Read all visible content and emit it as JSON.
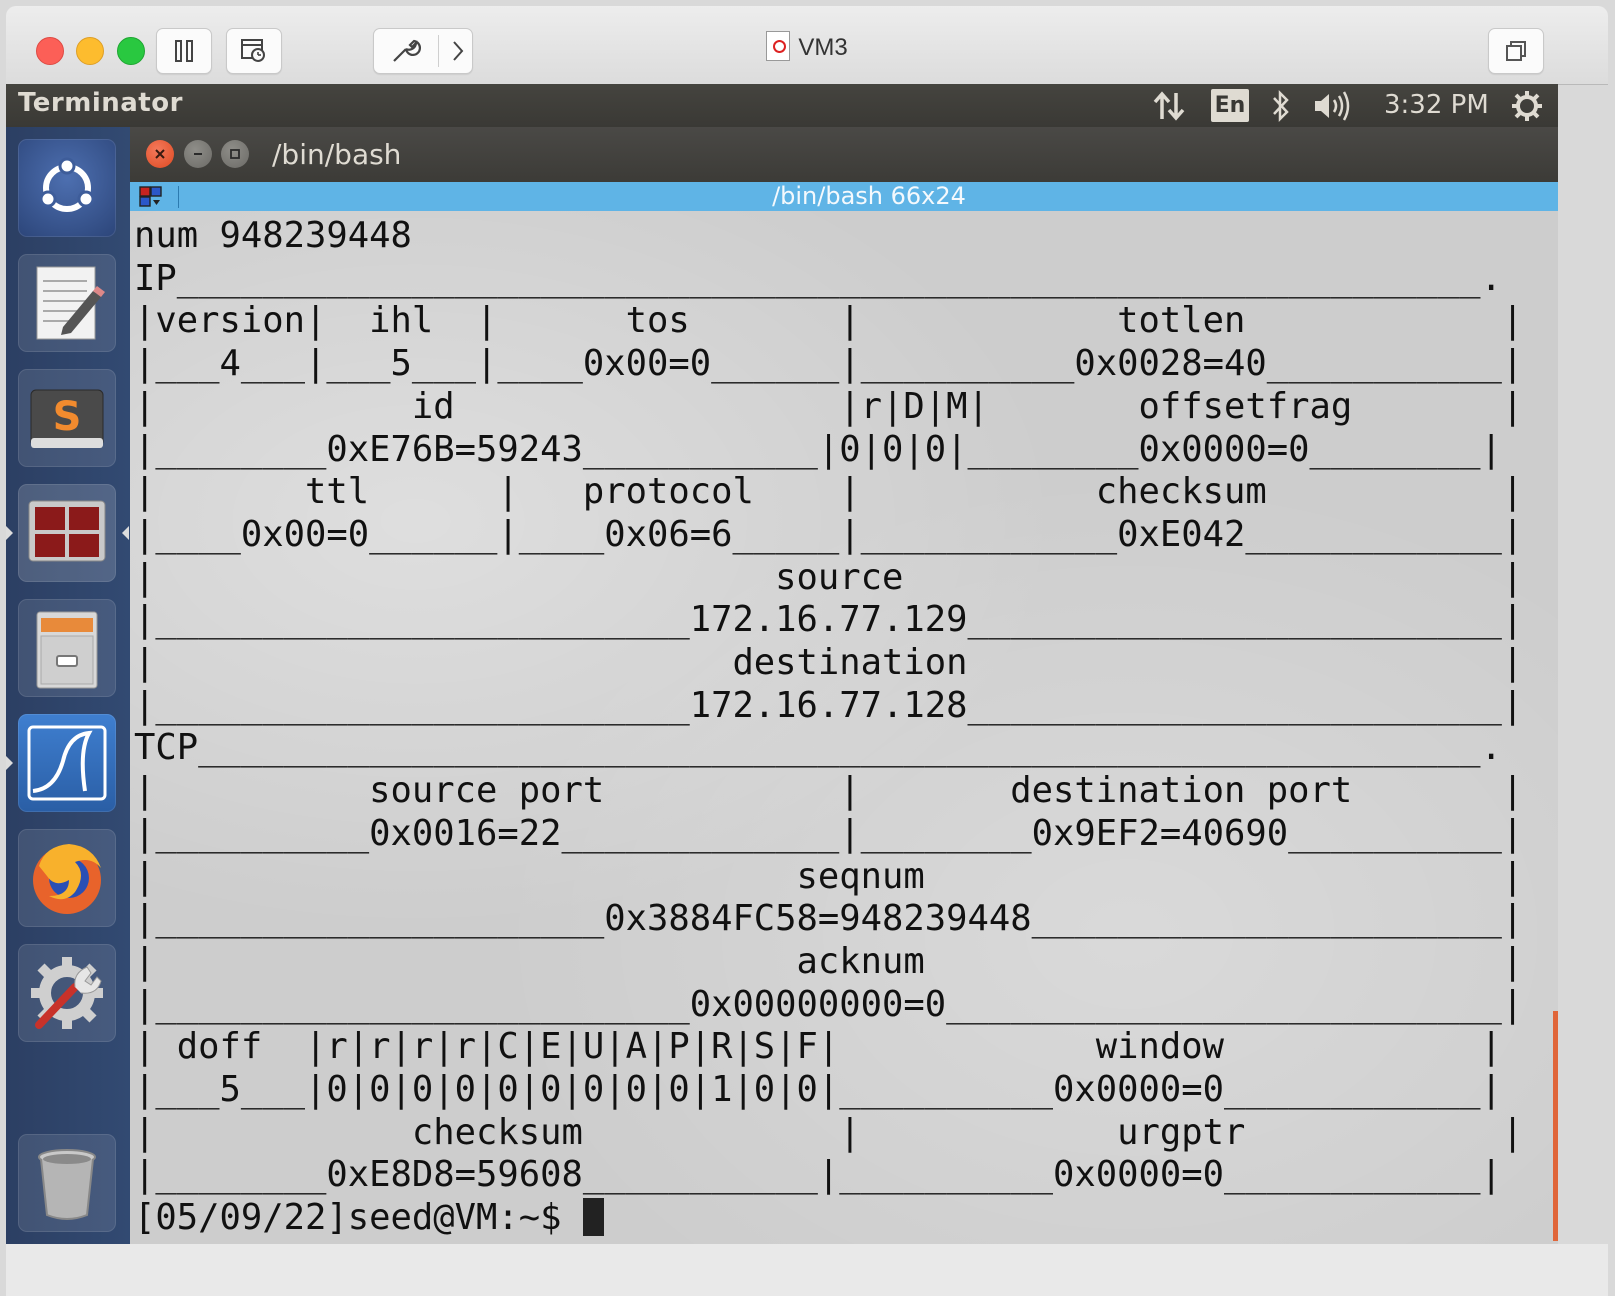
{
  "host_window": {
    "title": "VM3"
  },
  "panel": {
    "app_name": "Terminator",
    "lang": "En",
    "time": "3:32 PM"
  },
  "launcher": {
    "items": [
      {
        "name": "ubuntu-dash-icon"
      },
      {
        "name": "text-editor-icon"
      },
      {
        "name": "sublime-text-icon"
      },
      {
        "name": "terminator-icon"
      },
      {
        "name": "file-cabinet-icon"
      },
      {
        "name": "wireshark-icon"
      },
      {
        "name": "firefox-icon"
      },
      {
        "name": "system-settings-icon"
      },
      {
        "name": "trash-icon"
      }
    ]
  },
  "terminal": {
    "window_title": "/bin/bash",
    "bar_title": "/bin/bash 66x24",
    "lines": [
      "num 948239448",
      "IP_____________________________________________________________.",
      "|version|  ihl  |      tos       |            totlen            |",
      "|___4___|___5___|____0x00=0______|__________0x0028=40___________|",
      "|            id                  |r|D|M|       offsetfrag       |",
      "|________0xE76B=59243___________|0|0|0|________0x0000=0________|",
      "|       ttl      |   protocol    |           checksum           |",
      "|____0x00=0______|____0x06=6_____|____________0xE042____________|",
      "|                             source                            |",
      "|_________________________172.16.77.129_________________________|",
      "|                           destination                         |",
      "|_________________________172.16.77.128_________________________|",
      "TCP____________________________________________________________.",
      "|          source port           |       destination port       |",
      "|__________0x0016=22_____________|________0x9EF2=40690__________|",
      "|                              seqnum                           |",
      "|_____________________0x3884FC58=948239448______________________|",
      "|                              acknum                           |",
      "|_________________________0x00000000=0__________________________|",
      "| doff  |r|r|r|r|C|E|U|A|P|R|S|F|            window            |",
      "|___5___|0|0|0|0|0|0|0|0|0|1|0|0|__________0x0000=0____________|",
      "|            checksum            |            urgptr            |",
      "|________0xE8D8=59608___________|__________0x0000=0____________|"
    ],
    "prompt": "[05/09/22]seed@VM:~$ "
  }
}
